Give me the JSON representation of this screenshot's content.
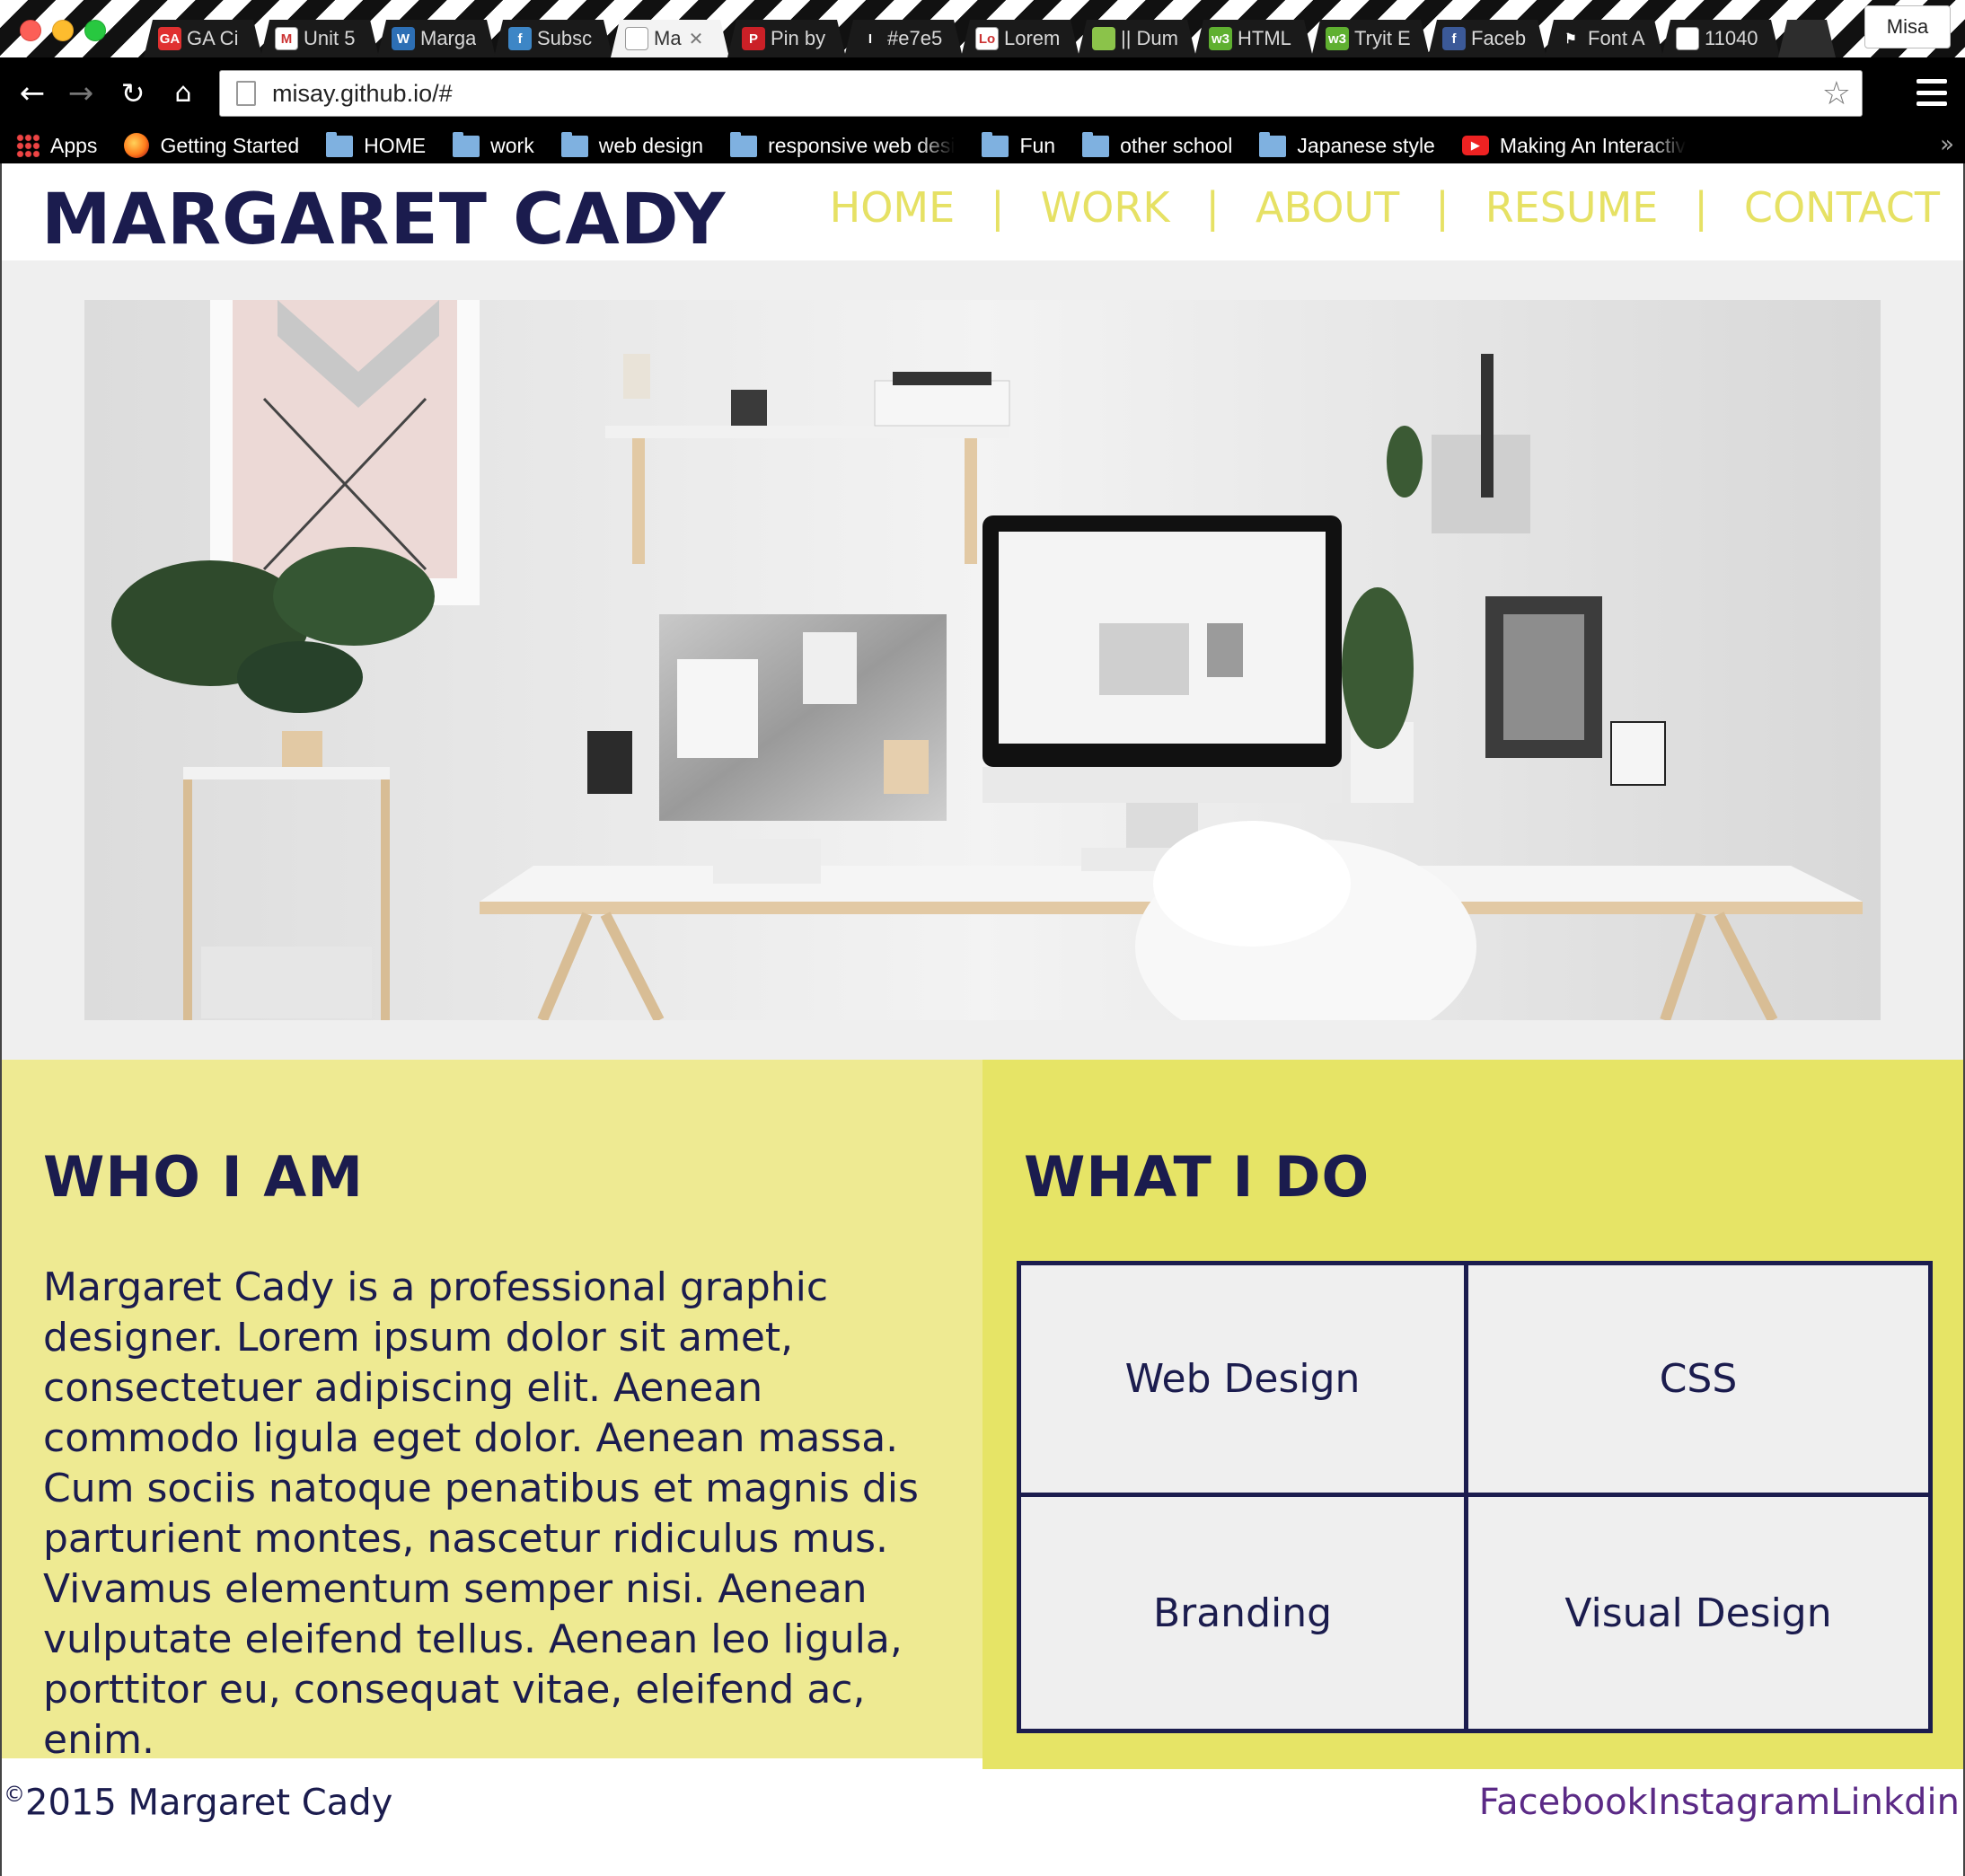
{
  "browser": {
    "tabs": [
      {
        "title": "GA Ci",
        "icon": "ga-icon",
        "icon_color": "#e03030",
        "icon_text": "GA"
      },
      {
        "title": "Unit 5",
        "icon": "gmail-icon",
        "icon_color": "#ffffff",
        "icon_text": "M"
      },
      {
        "title": "Marga",
        "icon": "wordpress-icon",
        "icon_color": "#2d6fb5",
        "icon_text": "W"
      },
      {
        "title": "Subsc",
        "icon": "feed-icon",
        "icon_color": "#3d86c6",
        "icon_text": "f"
      },
      {
        "title": "Ma",
        "icon": "page-icon",
        "icon_color": "#ffffff",
        "icon_text": "",
        "active": true
      },
      {
        "title": "Pin by",
        "icon": "pinterest-icon",
        "icon_color": "#cb2027",
        "icon_text": "P"
      },
      {
        "title": "#e7e5",
        "icon": "pin-icon",
        "icon_color": "#1a1a1a",
        "icon_text": "I"
      },
      {
        "title": "Lorem",
        "icon": "lorem-icon",
        "icon_color": "#ffffff",
        "icon_text": "Lo"
      },
      {
        "title": "|| Dum",
        "icon": "dummy-icon",
        "icon_color": "#8bc34a",
        "icon_text": ""
      },
      {
        "title": "HTML",
        "icon": "w3-icon",
        "icon_color": "#5fb030",
        "icon_text": "w3"
      },
      {
        "title": "Tryit E",
        "icon": "w3-icon",
        "icon_color": "#5fb030",
        "icon_text": "w3"
      },
      {
        "title": "Faceb",
        "icon": "facebook-icon",
        "icon_color": "#3b5998",
        "icon_text": "f"
      },
      {
        "title": "Font A",
        "icon": "flag-icon",
        "icon_color": "#1a1a1a",
        "icon_text": "⚑"
      },
      {
        "title": "11040",
        "icon": "page-icon",
        "icon_color": "#ffffff",
        "icon_text": ""
      }
    ],
    "profile_name": "Misa",
    "url": "misay.github.io/#",
    "bookmarks": [
      {
        "label": "Apps",
        "icon": "apps-icon"
      },
      {
        "label": "Getting Started",
        "icon": "firefox-icon"
      },
      {
        "label": "HOME",
        "icon": "folder-icon"
      },
      {
        "label": "work",
        "icon": "folder-icon"
      },
      {
        "label": "web design",
        "icon": "folder-icon"
      },
      {
        "label": "responsive web desi",
        "icon": "folder-icon"
      },
      {
        "label": "Fun",
        "icon": "folder-icon"
      },
      {
        "label": "other school",
        "icon": "folder-icon"
      },
      {
        "label": "Japanese style",
        "icon": "folder-icon"
      },
      {
        "label": "Making An Interactiv",
        "icon": "youtube-icon"
      }
    ],
    "bookmarks_overflow": "»"
  },
  "site": {
    "title": "MARGARET CADY",
    "nav": [
      "HOME",
      "WORK",
      "ABOUT",
      "RESUME",
      "CONTACT"
    ],
    "nav_separator": "|",
    "who": {
      "heading": "WHO I AM",
      "text": "Margaret Cady is a professional graphic designer. Lorem ipsum dolor sit amet, consectetuer adipiscing elit. Aenean commodo ligula eget dolor. Aenean massa. Cum sociis natoque penatibus et magnis dis parturient montes, nascetur ridiculus mus. Vivamus elementum semper nisi. Aenean vulputate eleifend tellus. Aenean leo ligula, porttitor eu, consequat vitae, eleifend ac, enim."
    },
    "what": {
      "heading": "WHAT I DO",
      "skills": [
        "Web Design",
        "CSS",
        "Branding",
        "Visual Design"
      ]
    },
    "footer": {
      "copyright_symbol": "©",
      "copyright_text": "2015 Margaret Cady",
      "social": [
        "Facebook",
        "Instagram",
        "Linkdin"
      ]
    }
  },
  "colors": {
    "navy": "#1b1c4e",
    "nav_yellow": "#e6e164",
    "who_bg": "#eeea92",
    "what_bg": "#e6e466",
    "hero_bg": "#efefef",
    "social_link": "#5b2a86"
  }
}
